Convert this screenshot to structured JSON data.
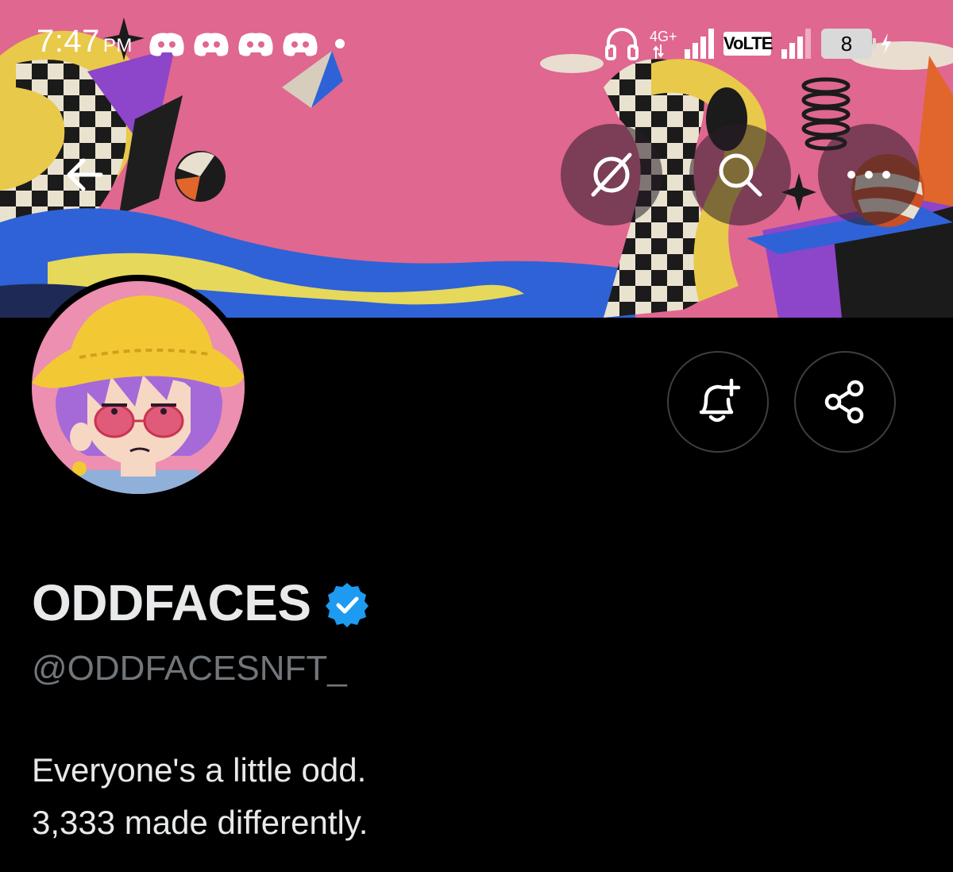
{
  "status_bar": {
    "time": "7:47",
    "ampm": "PM",
    "network": "4G+",
    "volte": "VoLTE",
    "battery": "8",
    "notification_icons": [
      "discord-icon",
      "discord-icon",
      "discord-icon",
      "discord-icon"
    ]
  },
  "header": {
    "back_icon": "arrow-left-icon",
    "actions": [
      "grok-icon",
      "search-icon",
      "more-icon"
    ]
  },
  "profile": {
    "display_name": "ODDFACES",
    "handle": "@ODDFACESNFT_",
    "verified": true,
    "bio_lines": [
      "Everyone's a little odd.",
      "3,333 made differently."
    ],
    "notify_icon": "bell-plus-icon",
    "share_icon": "share-icon"
  },
  "colors": {
    "banner_pink": "#e0678f",
    "verified_blue": "#1d9bf0",
    "handle_gray": "#71767b",
    "text_primary": "#e7e9ea",
    "background": "#000000"
  }
}
